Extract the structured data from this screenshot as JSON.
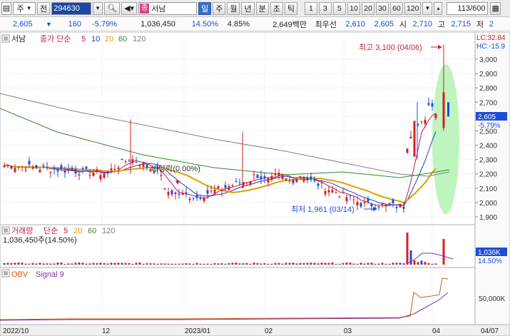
{
  "toolbar": {
    "type_select": "주",
    "jeon_label": "전",
    "code": "294630",
    "name_badge": "종",
    "name": "서남",
    "periods": [
      "일",
      "주",
      "월",
      "년",
      "분",
      "초",
      "틱"
    ],
    "active_period": "일",
    "intervals": [
      "1",
      "3",
      "5",
      "10",
      "20",
      "30",
      "60",
      "120"
    ],
    "counter": "113/600"
  },
  "quote": {
    "price": "2,605",
    "change": "160",
    "change_pct": "-5.79%",
    "volume": "1,036,450",
    "volume_pct": "14.50%",
    "turnover": "4.85%",
    "amount": "2,649백만",
    "pre_label": "최우선",
    "best_ask": "2,610",
    "best_bid": "2,605",
    "open_label": "시",
    "open": "2,710",
    "high_label": "고",
    "high": "2,715",
    "low_label": "저",
    "low": "2"
  },
  "price_panel": {
    "legend_name": "서남",
    "legend_ma": "종가 단순",
    "ma_periods": [
      "5",
      "10",
      "20",
      "60",
      "120"
    ],
    "ma_colors": [
      "#c2185b",
      "#1e40af",
      "#e0a000",
      "#2e8b2e",
      "#808080"
    ],
    "lc_label": "LC:32.84",
    "hc_label": "HC:-15.9",
    "high_annotation": "최고 3,100 (04/06)",
    "low_annotation": "최저 1,961 (03/14)",
    "ex_div_annotation": "배당락(0.00%)",
    "current_price_tag": "2,605",
    "current_change_tag": "-5.79%",
    "y_ticks": [
      "3,000",
      "2,900",
      "2,800",
      "2,700",
      "2,600",
      "2,500",
      "2,400",
      "2,300",
      "2,200",
      "2,100",
      "2,000",
      "1,900"
    ]
  },
  "volume_panel": {
    "legend_name": "거래량",
    "legend_ma": "단순",
    "ma_periods": [
      "5",
      "20",
      "60",
      "120"
    ],
    "value_label": "1,036,450주(14.50%)",
    "tag_value": "1,036K",
    "tag_pct": "14.50%"
  },
  "obv_panel": {
    "legend_obv": "OBV",
    "legend_signal": "Signal 9",
    "y_tick": "50,000K"
  },
  "x_axis": {
    "labels": [
      "2022/10",
      "12",
      "2023/01",
      "02",
      "03",
      "04",
      "04/07"
    ]
  },
  "colors": {
    "up": "#d32020",
    "down": "#1d4ed8",
    "ellipse": "#8ee88e"
  }
}
